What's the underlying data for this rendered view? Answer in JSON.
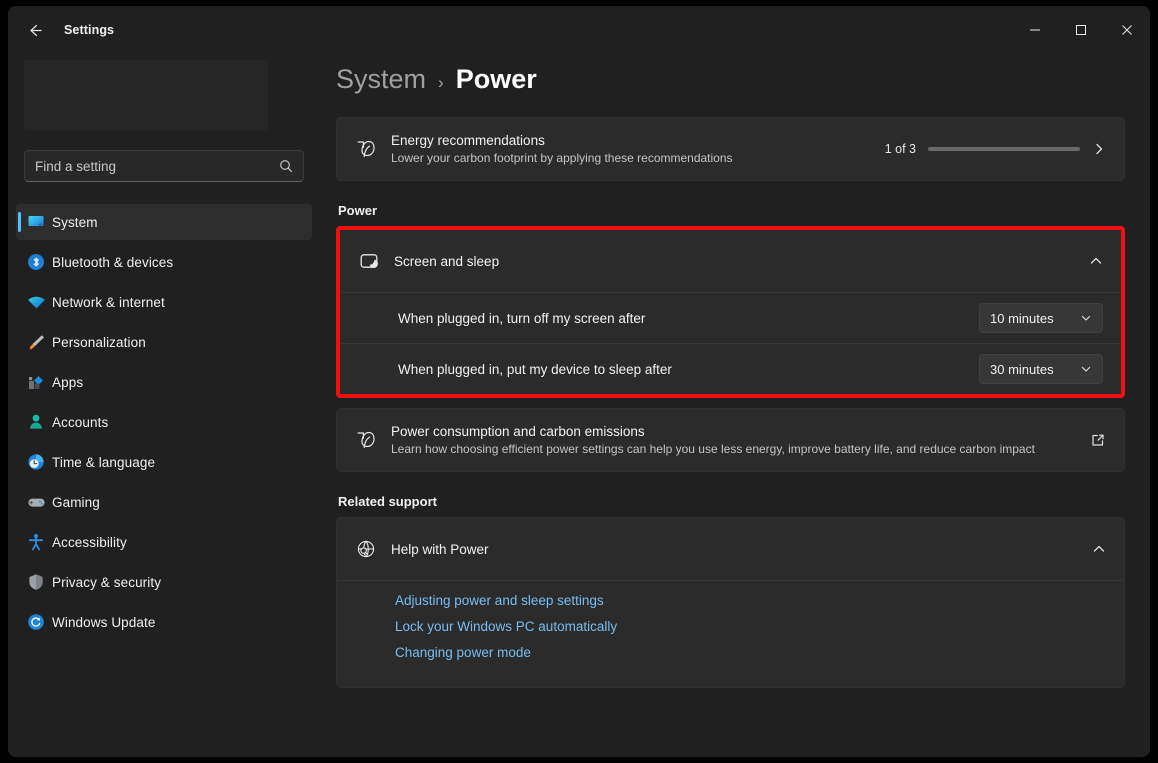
{
  "window": {
    "app_title": "Settings",
    "back_icon": "arrow-left-icon",
    "controls": {
      "minimize": "minimize-icon",
      "maximize": "maximize-icon",
      "close": "close-icon"
    }
  },
  "sidebar": {
    "search": {
      "placeholder": "Find a setting",
      "value": "",
      "icon": "search-icon"
    },
    "items": [
      {
        "label": "System",
        "icon": "monitor-icon",
        "active": true
      },
      {
        "label": "Bluetooth & devices",
        "icon": "bluetooth-icon",
        "active": false
      },
      {
        "label": "Network & internet",
        "icon": "wifi-icon",
        "active": false
      },
      {
        "label": "Personalization",
        "icon": "paintbrush-icon",
        "active": false
      },
      {
        "label": "Apps",
        "icon": "apps-icon",
        "active": false
      },
      {
        "label": "Accounts",
        "icon": "person-icon",
        "active": false
      },
      {
        "label": "Time & language",
        "icon": "clock-globe-icon",
        "active": false
      },
      {
        "label": "Gaming",
        "icon": "gamepad-icon",
        "active": false
      },
      {
        "label": "Accessibility",
        "icon": "accessibility-icon",
        "active": false
      },
      {
        "label": "Privacy & security",
        "icon": "shield-icon",
        "active": false
      },
      {
        "label": "Windows Update",
        "icon": "update-refresh-icon",
        "active": false
      }
    ]
  },
  "header": {
    "parent": "System",
    "separator": "›",
    "current": "Power"
  },
  "energy_card": {
    "icon": "leaf-icon",
    "title": "Energy recommendations",
    "subtitle": "Lower your carbon footprint by applying these recommendations",
    "progress_label": "1 of 3",
    "progress_percent": 33,
    "chevron_icon": "chevron-right-icon"
  },
  "power_section": {
    "heading": "Power",
    "screen_and_sleep": {
      "icon": "monitor-sleep-icon",
      "title": "Screen and sleep",
      "expanded": true,
      "chevron_icon": "chevron-up-icon",
      "settings": [
        {
          "label": "When plugged in, turn off my screen after",
          "value": "10 minutes",
          "chevron_icon": "chevron-down-icon"
        },
        {
          "label": "When plugged in, put my device to sleep after",
          "value": "30 minutes",
          "chevron_icon": "chevron-down-icon"
        }
      ]
    },
    "consumption_card": {
      "icon": "leaf-icon",
      "title": "Power consumption and carbon emissions",
      "subtitle": "Learn how choosing efficient power settings can help you use less energy, improve battery life, and reduce carbon impact",
      "action_icon": "open-external-icon"
    }
  },
  "related_support": {
    "heading": "Related support",
    "help_card": {
      "icon": "globe-search-icon",
      "title": "Help with Power",
      "expanded": true,
      "chevron_icon": "chevron-up-icon",
      "links": [
        "Adjusting power and sleep settings",
        "Lock your Windows PC automatically",
        "Changing power mode"
      ]
    }
  },
  "annotation": {
    "highlight_color": "#ee1111",
    "target": "Screen and sleep"
  },
  "colors": {
    "accent": "#0a7ddb",
    "link": "#79bdf0",
    "card_bg": "#2b2b2b",
    "page_bg": "#202020",
    "sidebar_indicator": "#4cc2ff"
  }
}
